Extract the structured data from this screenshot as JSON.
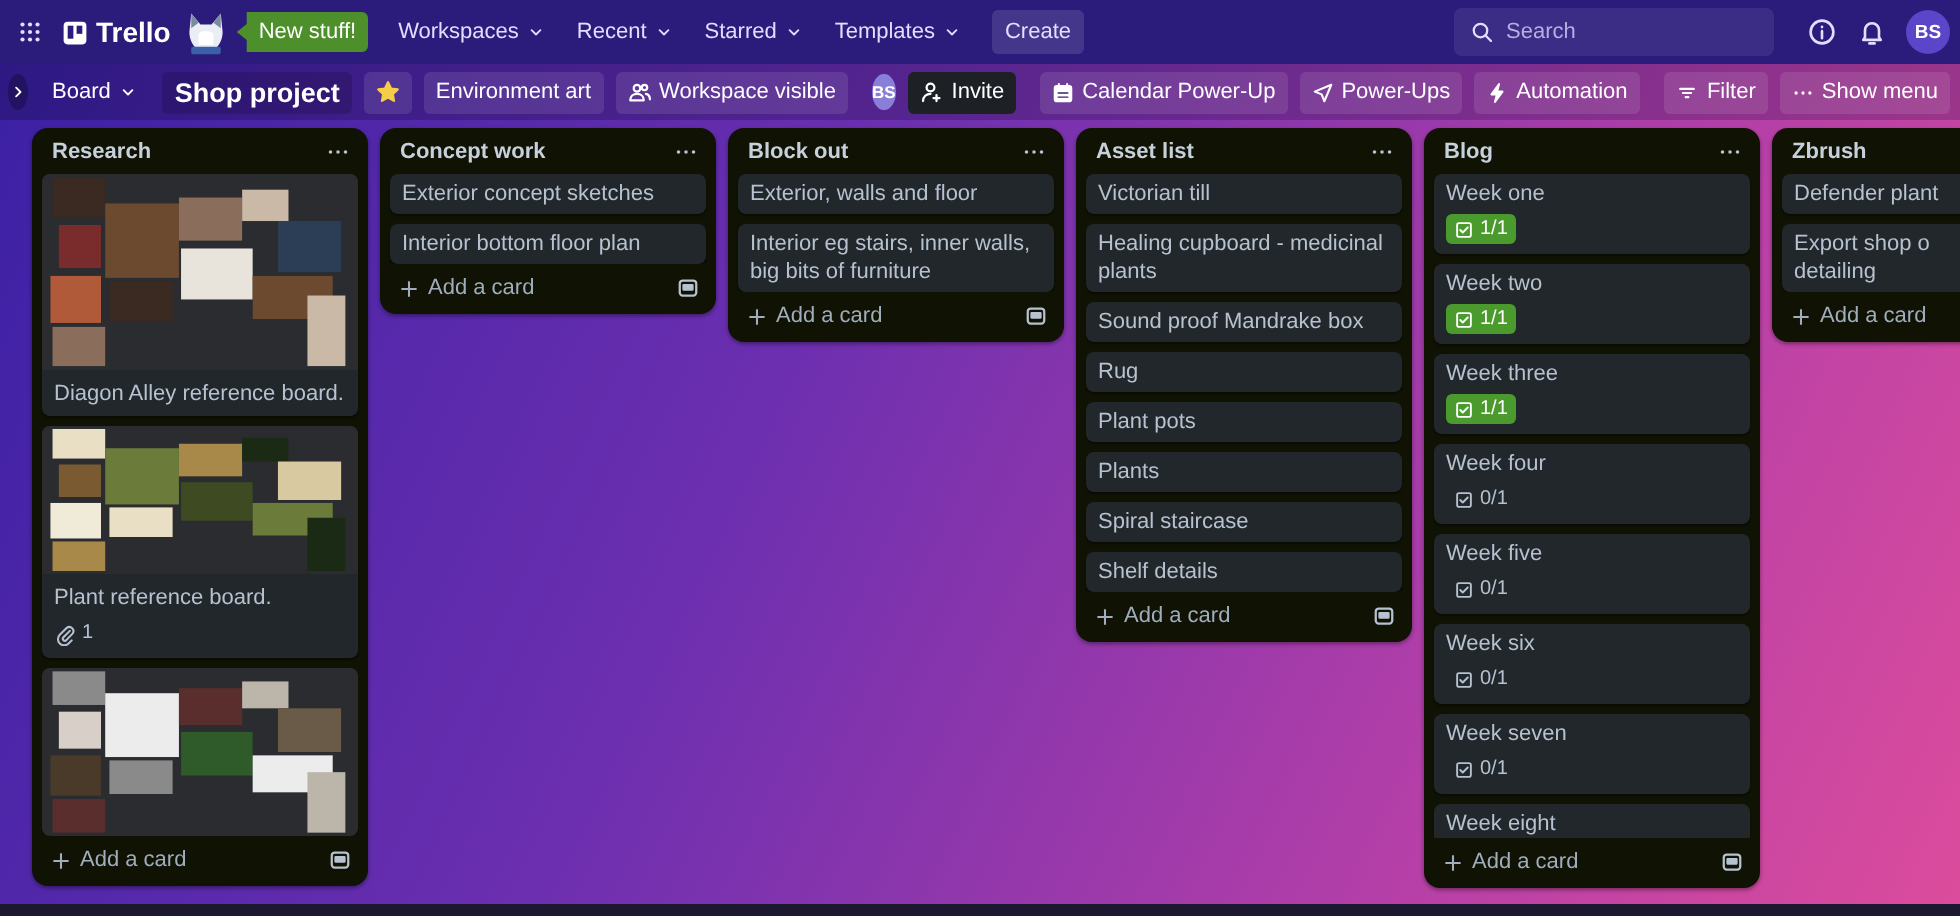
{
  "top_bar": {
    "app_name": "Trello",
    "promo": "New stuff!",
    "menus": [
      {
        "label": "Workspaces"
      },
      {
        "label": "Recent"
      },
      {
        "label": "Starred"
      },
      {
        "label": "Templates"
      }
    ],
    "create": "Create",
    "search": {
      "placeholder": "Search"
    },
    "avatar": "BS"
  },
  "board_bar": {
    "view": "Board",
    "title": "Shop project",
    "starred": true,
    "workspace": "Environment art",
    "visibility": "Workspace visible",
    "member": "BS",
    "invite": "Invite",
    "actions": [
      {
        "kind": "calendar",
        "label": "Calendar Power-Up"
      },
      {
        "kind": "power-ups",
        "label": "Power-Ups"
      },
      {
        "kind": "automation",
        "label": "Automation"
      },
      {
        "kind": "filter",
        "label": "Filter"
      },
      {
        "kind": "menu",
        "label": "Show menu"
      }
    ]
  },
  "lists": [
    {
      "title": "Research",
      "add": "Add a card",
      "cards": [
        {
          "kind": "cover",
          "title": "Diagon Alley reference board."
        },
        {
          "kind": "cover",
          "title": "Plant reference board.",
          "attachments": "1"
        },
        {
          "kind": "cover"
        }
      ]
    },
    {
      "title": "Concept work",
      "add": "Add a card",
      "cards": [
        {
          "kind": "text",
          "title": "Exterior concept sketches"
        },
        {
          "kind": "text",
          "title": "Interior bottom floor plan"
        }
      ]
    },
    {
      "title": "Block out",
      "add": "Add a card",
      "cards": [
        {
          "kind": "text",
          "title": "Exterior, walls and floor"
        },
        {
          "kind": "text",
          "title": "Interior eg stairs, inner walls, big bits of furniture"
        }
      ]
    },
    {
      "title": "Asset list",
      "add": "Add a card",
      "cards": [
        {
          "kind": "text",
          "title": "Victorian till"
        },
        {
          "kind": "text",
          "title": "Healing cupboard - medicinal plants"
        },
        {
          "kind": "text",
          "title": "Sound proof Mandrake box"
        },
        {
          "kind": "text",
          "title": "Rug"
        },
        {
          "kind": "text",
          "title": "Plant pots"
        },
        {
          "kind": "text",
          "title": "Plants"
        },
        {
          "kind": "text",
          "title": "Spiral staircase"
        },
        {
          "kind": "text",
          "title": "Shelf details"
        }
      ]
    },
    {
      "title": "Blog",
      "add": "Add a card",
      "cards": [
        {
          "kind": "text",
          "title": "Week one",
          "checklist": "1/1",
          "complete": true
        },
        {
          "kind": "text",
          "title": "Week two",
          "checklist": "1/1",
          "complete": true
        },
        {
          "kind": "text",
          "title": "Week three",
          "checklist": "1/1",
          "complete": true
        },
        {
          "kind": "text",
          "title": "Week four",
          "checklist": "0/1",
          "complete": false
        },
        {
          "kind": "text",
          "title": "Week five",
          "checklist": "0/1",
          "complete": false
        },
        {
          "kind": "text",
          "title": "Week six",
          "checklist": "0/1",
          "complete": false
        },
        {
          "kind": "text",
          "title": "Week seven",
          "checklist": "0/1",
          "complete": false
        },
        {
          "kind": "text",
          "title": "Week eight"
        }
      ]
    },
    {
      "title": "Zbrush",
      "add": "Add a card",
      "cards": [
        {
          "kind": "text",
          "title": "Defender plant"
        },
        {
          "kind": "text",
          "title": "Export shop o\ndetailing"
        }
      ]
    }
  ]
}
